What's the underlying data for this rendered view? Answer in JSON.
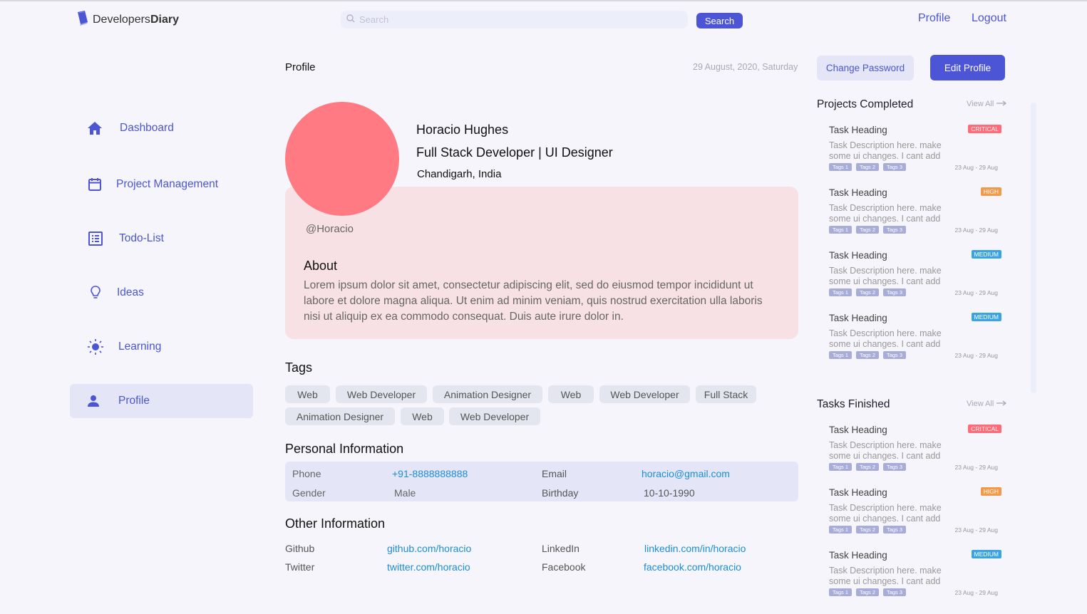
{
  "header": {
    "logo_prefix": "Developers",
    "logo_bold": "Diary",
    "search_placeholder": "Search",
    "search_button": "Search",
    "profile_link": "Profile",
    "logout_link": "Logout"
  },
  "sidebar": {
    "items": [
      {
        "label": "Dashboard",
        "icon": "home-icon"
      },
      {
        "label": "Project Management",
        "icon": "calendar-icon"
      },
      {
        "label": "Todo-List",
        "icon": "list-icon"
      },
      {
        "label": "Ideas",
        "icon": "lightbulb-icon"
      },
      {
        "label": "Learning",
        "icon": "sun-icon"
      },
      {
        "label": "Profile",
        "icon": "user-icon",
        "active": true
      }
    ]
  },
  "main": {
    "title": "Profile",
    "date": "29 August, 2020, Saturday",
    "change_password": "Change Password",
    "edit_profile": "Edit Profile",
    "profile": {
      "name": "Horacio Hughes",
      "role": "Full Stack Developer | UI Designer",
      "location": "Chandigarh, India",
      "handle": "@Horacio",
      "about_heading": "About",
      "about_text": "Lorem ipsum dolor sit amet, consectetur adipiscing elit, sed do eiusmod tempor incididunt ut labore et dolore magna aliqua. Ut enim ad minim veniam, quis nostrud exercitation ulla laboris nisi ut aliquip ex ea commodo consequat. Duis aute irure dolor in.",
      "avatar_color": "#ff7a83"
    },
    "tags_heading": "Tags",
    "tags": [
      "Web",
      "Web Developer",
      "Animation Designer",
      "Web",
      "Web Developer",
      "Full Stack",
      "Animation Designer",
      "Web",
      "Web Developer"
    ],
    "personal_heading": "Personal Information",
    "personal": {
      "phone_label": "Phone",
      "phone": "+91-8888888888",
      "email_label": "Email",
      "email": "horacio@gmail.com",
      "gender_label": "Gender",
      "gender": "Male",
      "birthday_label": "Birthday",
      "birthday": "10-10-1990"
    },
    "other_heading": "Other Information",
    "other": {
      "github_label": "Github",
      "github": "github.com/horacio",
      "linkedin_label": "LinkedIn",
      "linkedin": "linkedin.com/in/horacio",
      "twitter_label": "Twitter",
      "twitter": "twitter.com/horacio",
      "facebook_label": "Facebook",
      "facebook": "facebook.com/horacio"
    }
  },
  "right_panel": {
    "projects_heading": "Projects Completed",
    "tasks_heading": "Tasks Finished",
    "view_all": "View All",
    "projects": [
      {
        "heading": "Task Heading",
        "desc": "Task Description here. make some ui changes. I cant add",
        "priority": "CRITICAL",
        "tags": [
          "Tags 1",
          "Tags 2",
          "Tags 3"
        ],
        "date": "23 Aug - 29 Aug"
      },
      {
        "heading": "Task Heading",
        "desc": "Task Description here. make some ui changes. I cant add",
        "priority": "HIGH",
        "tags": [
          "Tags 1",
          "Tags 2",
          "Tags 3"
        ],
        "date": "23 Aug - 29 Aug"
      },
      {
        "heading": "Task Heading",
        "desc": "Task Description here. make some ui changes. I cant add",
        "priority": "MEDIUM",
        "tags": [
          "Tags 1",
          "Tags 2",
          "Tags 3"
        ],
        "date": "23 Aug - 29 Aug"
      },
      {
        "heading": "Task Heading",
        "desc": "Task Description here. make some ui changes. I cant add",
        "priority": "MEDIUM",
        "tags": [
          "Tags 1",
          "Tags 2",
          "Tags 3"
        ],
        "date": "23 Aug - 29 Aug"
      }
    ],
    "tasks": [
      {
        "heading": "Task Heading",
        "desc": "Task Description here. make some ui changes. I cant add",
        "priority": "CRITICAL",
        "tags": [
          "Tags 1",
          "Tags 2",
          "Tags 3"
        ],
        "date": "23 Aug - 29 Aug"
      },
      {
        "heading": "Task Heading",
        "desc": "Task Description here. make some ui changes. I cant add",
        "priority": "HIGH",
        "tags": [
          "Tags 1",
          "Tags 2",
          "Tags 3"
        ],
        "date": "23 Aug - 29 Aug"
      },
      {
        "heading": "Task Heading",
        "desc": "Task Description here. make some ui changes. I cant add",
        "priority": "MEDIUM",
        "tags": [
          "Tags 1",
          "Tags 2",
          "Tags 3"
        ],
        "date": "23 Aug - 29 Aug"
      }
    ],
    "priority_colors": {
      "CRITICAL": "#ff6b78",
      "HIGH": "#f2994a",
      "MEDIUM": "#3aa3e3"
    }
  }
}
